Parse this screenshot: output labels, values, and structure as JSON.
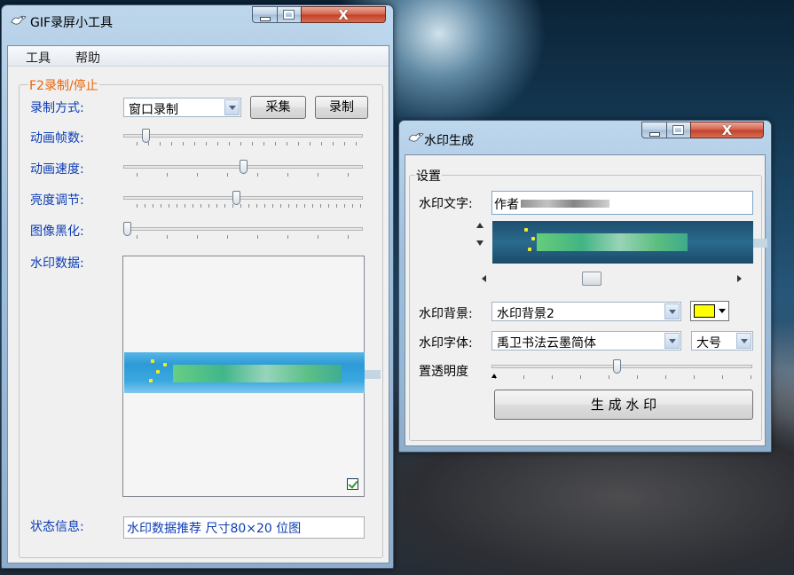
{
  "colors": {
    "accent_blue": "#0c3cb4",
    "legend_orange": "#e8650b",
    "swatch": "#ffff00",
    "banner_blue": "#2d9ad6",
    "banner_dark": "#1e5a7e"
  },
  "main_window": {
    "title": "GIF录屏小工具",
    "icon": "app-bird-icon",
    "menu": [
      "工具",
      "帮助"
    ],
    "group_label": "F2录制/停止",
    "record_mode_label": "录制方式:",
    "record_mode_value": "窗口录制",
    "capture_button": "采集",
    "record_button": "录制",
    "frames_label": "动画帧数:",
    "frames_level": 0.08,
    "speed_label": "动画速度:",
    "speed_level": 0.5,
    "brightness_label": "亮度调节:",
    "brightness_level": 0.47,
    "blacken_label": "图像黑化:",
    "blacken_level": 0.0,
    "watermark_data_label": "水印数据:",
    "watermark_checkbox_checked": true,
    "status_label": "状态信息:",
    "status_value": "水印数据推荐 尺寸80×20 位图"
  },
  "watermark_window": {
    "title": "水印生成",
    "icon": "app-bird-icon",
    "group_label": "设置",
    "text_label": "水印文字:",
    "text_value": "作者",
    "background_label": "水印背景:",
    "background_value": "水印背景2",
    "font_label": "水印字体:",
    "font_value": "禹卫书法云墨简体",
    "size_value": "大号",
    "transparency_label": "置透明度",
    "transparency_level": 0.48,
    "generate_button": "生 成 水 印"
  }
}
